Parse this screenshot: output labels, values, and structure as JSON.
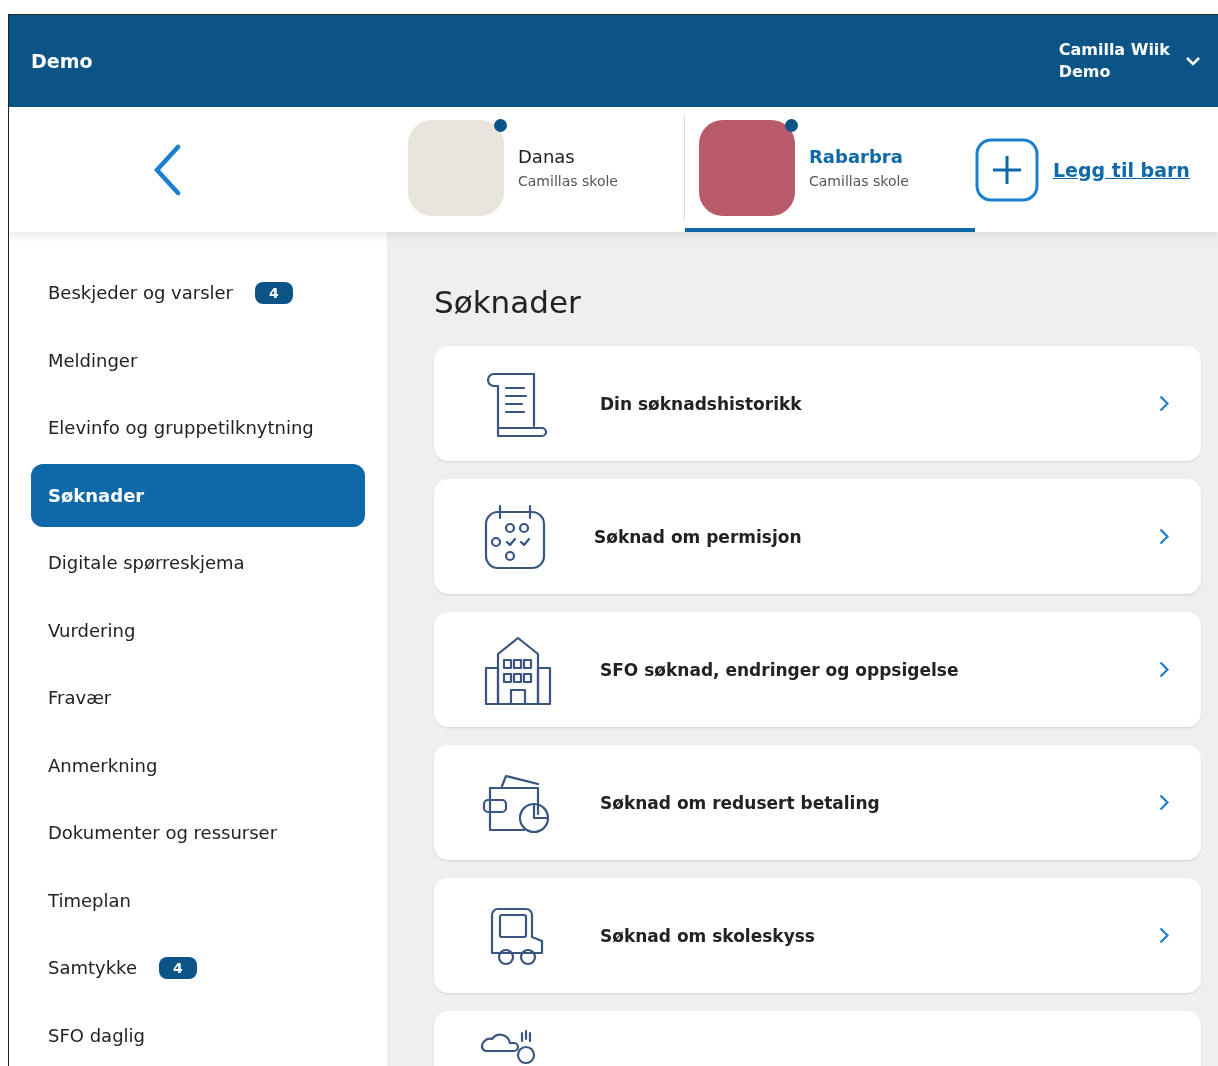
{
  "header": {
    "title": "Demo",
    "user": {
      "name": "Camilla Wiik",
      "role": "Demo"
    }
  },
  "children": [
    {
      "name": "Danas",
      "school": "Camillas skole",
      "selected": false,
      "color": "#e9e4dc"
    },
    {
      "name": "Rabarbra",
      "school": "Camillas skole",
      "selected": true,
      "color": "#b85a6a"
    }
  ],
  "add_child": {
    "label": "Legg til barn"
  },
  "sidebar": {
    "items": [
      {
        "label": "Beskjeder og varsler",
        "badge": "4",
        "selected": false
      },
      {
        "label": "Meldinger",
        "selected": false
      },
      {
        "label": "Elevinfo og gruppetilknytning",
        "selected": false
      },
      {
        "label": "Søknader",
        "selected": true
      },
      {
        "label": "Digitale spørreskjema",
        "selected": false
      },
      {
        "label": "Vurdering",
        "selected": false
      },
      {
        "label": "Fravær",
        "selected": false
      },
      {
        "label": "Anmerkning",
        "selected": false
      },
      {
        "label": "Dokumenter og ressurser",
        "selected": false
      },
      {
        "label": "Timeplan",
        "selected": false
      },
      {
        "label": "Samtykke",
        "badge": "4",
        "selected": false
      },
      {
        "label": "SFO daglig",
        "selected": false
      }
    ]
  },
  "main": {
    "heading": "Søknader",
    "cards": [
      {
        "kind": "scroll",
        "title": "Din søknadshistorikk"
      },
      {
        "kind": "calendar",
        "title": "Søknad om permisjon"
      },
      {
        "kind": "building",
        "title": "SFO søknad, endringer og oppsigelse"
      },
      {
        "kind": "wallet",
        "title": "Søknad om redusert betaling"
      },
      {
        "kind": "car",
        "title": "Søknad om skoleskyss"
      },
      {
        "kind": "weather"
      }
    ]
  }
}
